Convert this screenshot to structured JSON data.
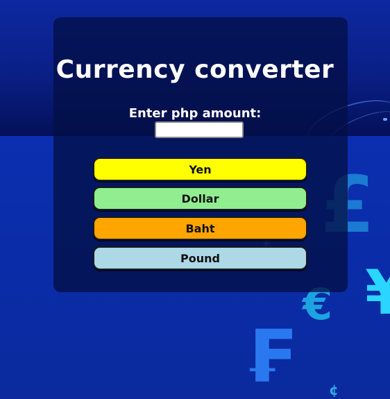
{
  "page": {
    "title": "Currency converter",
    "prompt": "Enter php amount:"
  },
  "input": {
    "value": "",
    "placeholder": ""
  },
  "buttons": [
    {
      "label": "Yen",
      "color": "#ffff00"
    },
    {
      "label": "Dollar",
      "color": "#90ee90"
    },
    {
      "label": "Baht",
      "color": "#ffa500"
    },
    {
      "label": "Pound",
      "color": "#add8e6"
    }
  ],
  "background_symbols": {
    "pound": "£",
    "yen": "¥",
    "euro": "€",
    "franc": "₣",
    "small": "₤",
    "bottom": "¢"
  },
  "colors": {
    "background": "#0a2aa6",
    "card": "#021046",
    "title_text": "#ffffff"
  }
}
